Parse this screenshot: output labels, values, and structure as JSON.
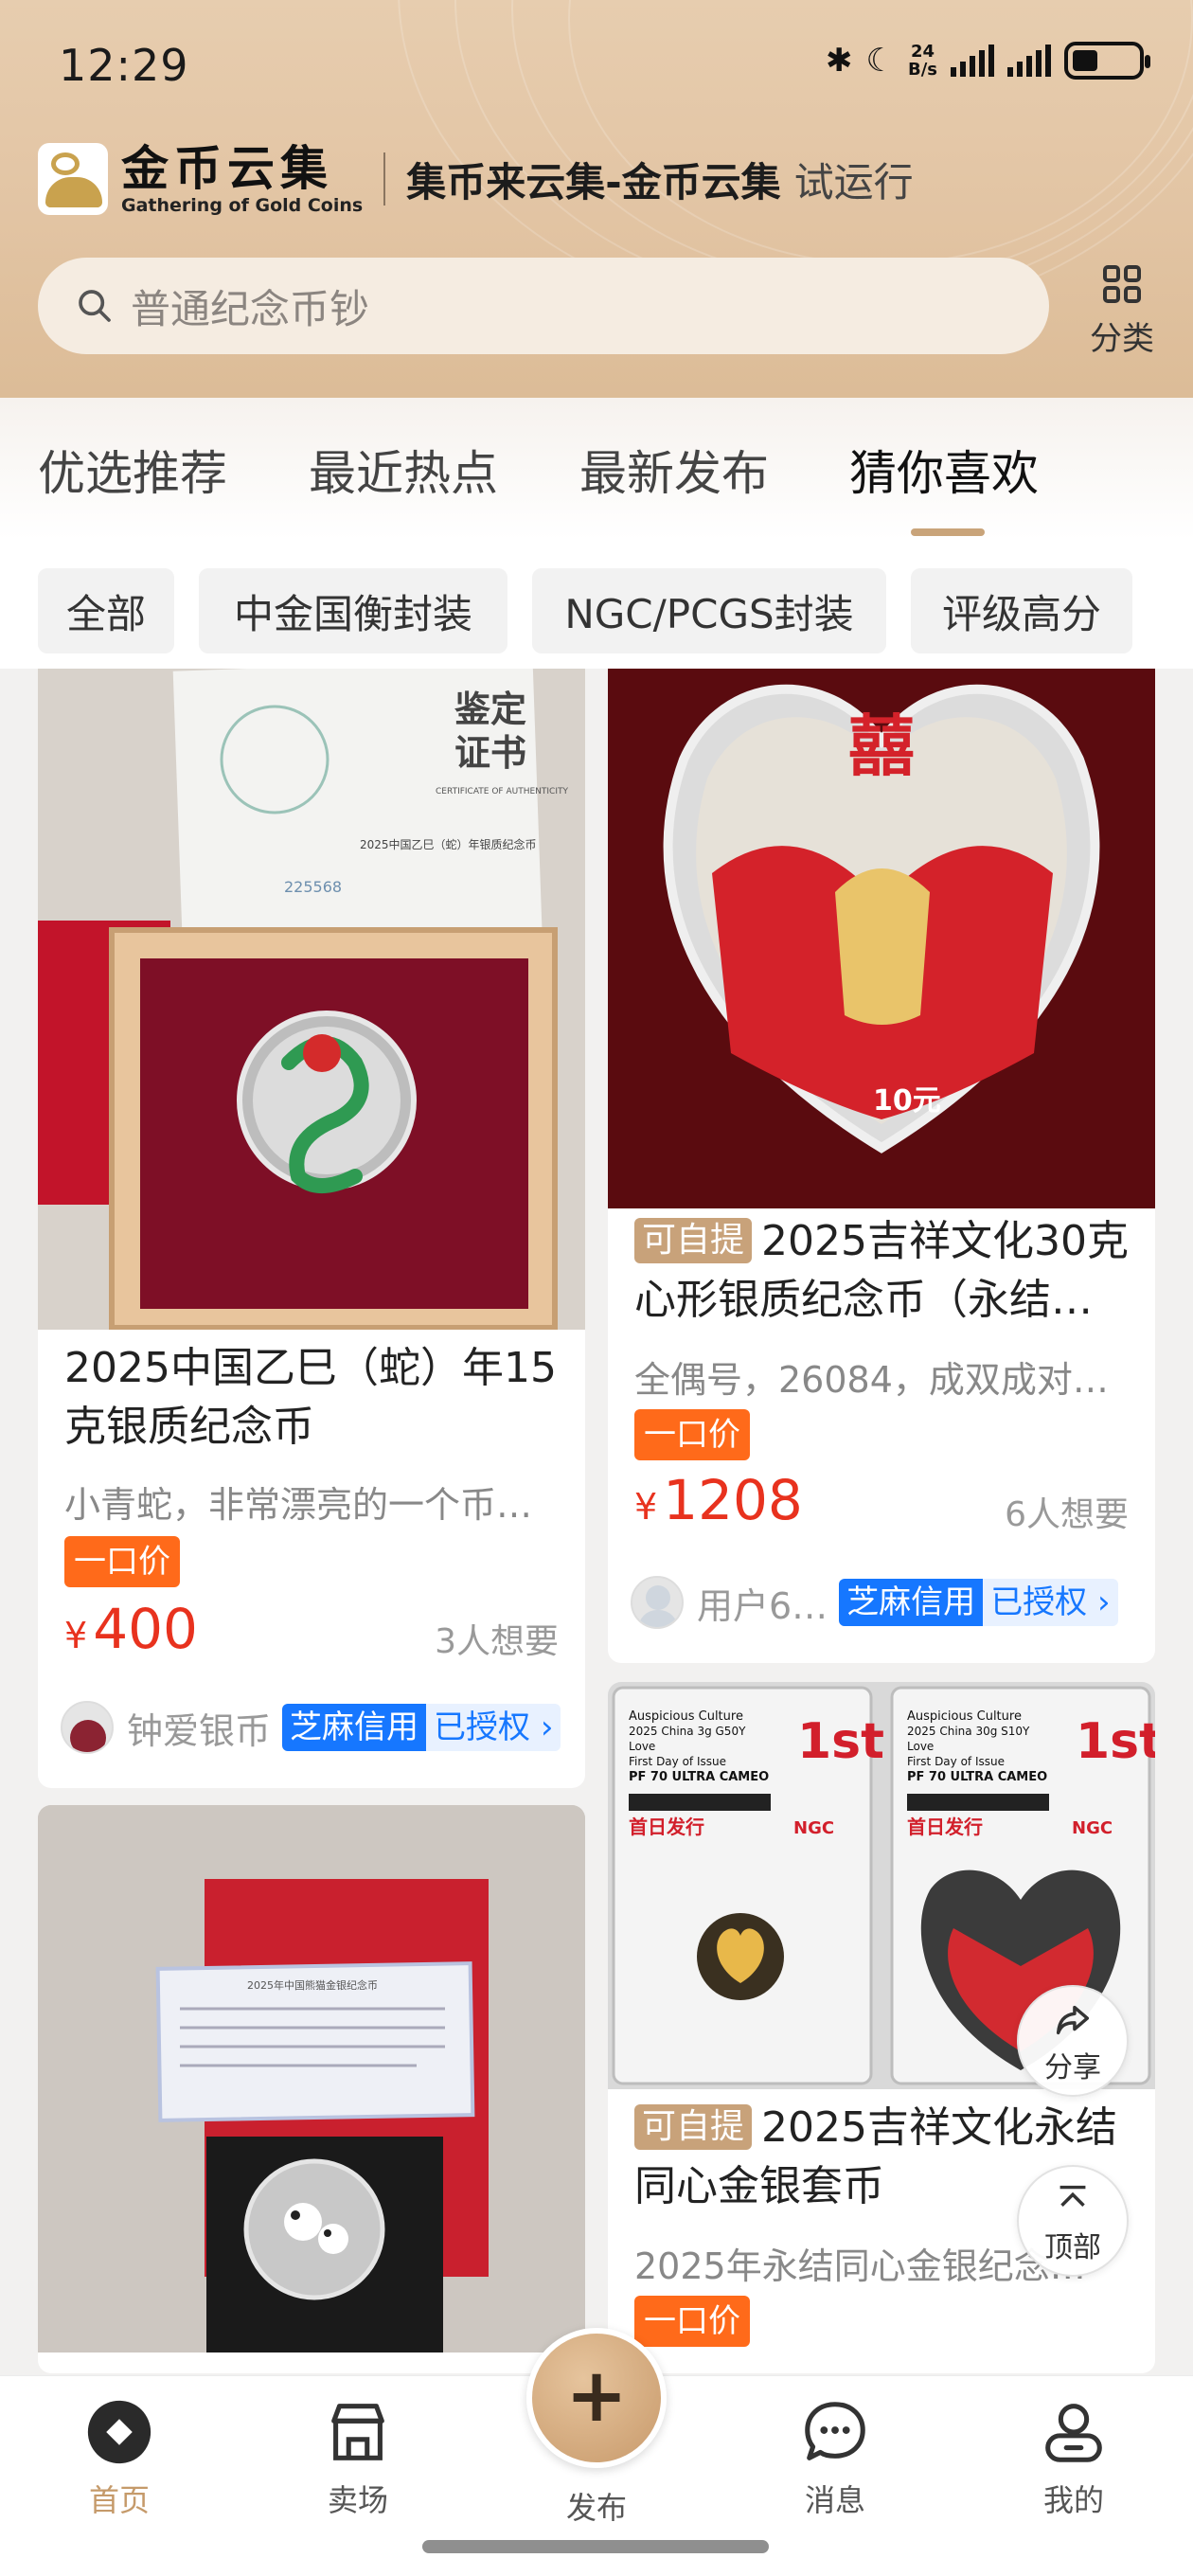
{
  "status": {
    "time": "12:29",
    "net_speed": "24",
    "net_unit": "B/s"
  },
  "brand": {
    "name_cn": "金币云集",
    "name_en": "Gathering of Gold Coins",
    "slogan": "集币来云集-金币云集",
    "trial": "试运行"
  },
  "search": {
    "placeholder": "普通纪念币钞"
  },
  "category": {
    "label": "分类"
  },
  "tabs": [
    "优选推荐",
    "最近热点",
    "最新发布",
    "猜你喜欢"
  ],
  "filters": [
    "全部",
    "中金国衡封装",
    "NGC/PCGS封装",
    "评级高分"
  ],
  "items": [
    {
      "title": "2025中国乙巳（蛇）年15克银质纪念币",
      "desc": "小青蛇，非常漂亮的一个币…",
      "badge": "一口价",
      "currency": "¥",
      "price": "400",
      "wants": "3人想要",
      "seller": "钟爱银币",
      "zhima": "芝麻信用",
      "auth": "已授权",
      "cert": {
        "title1": "鉴定",
        "title2": "证书",
        "sub": "CERTIFICATE OF AUTHENTICITY",
        "line": "2025中国乙巳（蛇）年银质纪念币",
        "serial": "225568"
      }
    },
    {
      "pickup": "可自提",
      "title": "2025吉祥文化30克心形银质纪念币（永结…",
      "desc": "全偶号，26084，成双成对…",
      "badge": "一口价",
      "currency": "¥",
      "price": "1208",
      "wants": "6人想要",
      "seller": "用户6…",
      "zhima": "芝麻信用",
      "auth": "已授权",
      "coin_text": "囍",
      "coin_value": "10元"
    },
    {
      "title": "",
      "img_text": "2025年中国熊猫金银纪念币"
    },
    {
      "pickup": "可自提",
      "title": "2025吉祥文化永结同心金银套币",
      "desc": "2025年永结同心金银纪念…",
      "badge": "一口价",
      "slab": {
        "l1": "Auspicious Culture",
        "l2a": "2025 China 3g G50Y",
        "l2b": "2025 China 30g S10Y",
        "l3": "Love",
        "l4": "First Day of Issue",
        "l5": "PF 70 ULTRA CAMEO",
        "first": "1st",
        "first_day": "首日发行",
        "grader": "NGC"
      }
    }
  ],
  "floats": {
    "share": "分享",
    "top": "顶部"
  },
  "bottom_nav": [
    "首页",
    "卖场",
    "发布",
    "消息",
    "我的"
  ],
  "colors": {
    "accent": "#c59a6a",
    "price": "#e8321e",
    "badge": "#ff6a1a",
    "zhima": "#1677ff",
    "header": "#e2c4a3"
  }
}
